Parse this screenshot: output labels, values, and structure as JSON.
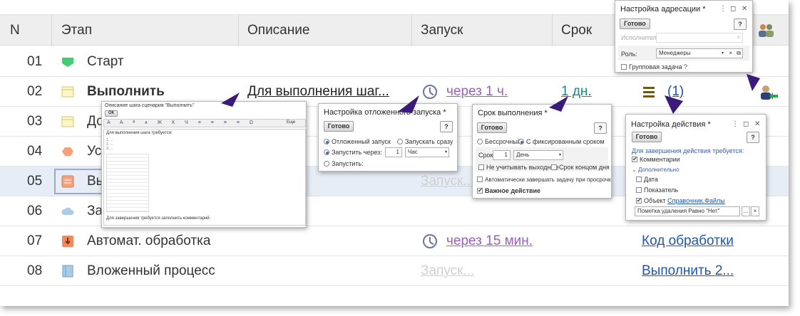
{
  "table": {
    "columns": {
      "n": "N",
      "stage": "Этап",
      "description": "Описание",
      "launch": "Запуск",
      "deadline": "Срок"
    },
    "rows": [
      {
        "n": "01",
        "name": "Старт",
        "icon": "start-icon"
      },
      {
        "n": "02",
        "name": "Выполнить",
        "description": "Для выполнения шаг...",
        "launch": "через 1 ч.",
        "deadline": "1 дн.",
        "actions": "(1)"
      },
      {
        "n": "03",
        "name": "До",
        "icon": "task-icon"
      },
      {
        "n": "04",
        "name": "Ус",
        "icon": "condition-icon"
      },
      {
        "n": "05",
        "name": "Вы",
        "launch": "Запуск..."
      },
      {
        "n": "06",
        "name": "За",
        "icon": "cloud-icon"
      },
      {
        "n": "07",
        "name": "Автомат. обработка",
        "launch": "через 15 мин.",
        "extra": "Код обработки"
      },
      {
        "n": "08",
        "name": "Вложенный процесс",
        "launch": "Запуск...",
        "extra": "Выполнить 2..."
      }
    ]
  },
  "popup_description": {
    "title": "Описание шага сценария \"Выполнить\"",
    "ok": "ОК",
    "toolbar_more": "Еще",
    "body_line": "Для выполнения шага требуется:",
    "footer": "Для завершения требуется заполнить комментарий."
  },
  "popup_delayed": {
    "title": "Настройка отложенного запуска *",
    "done": "Готово",
    "help": "?",
    "opt_delayed": "Отложенный запуск",
    "opt_now": "Запускать сразу",
    "opt_after": "Запустить через:",
    "after_value": "1",
    "after_unit": "Час",
    "opt_at": "Запустить:"
  },
  "popup_deadline": {
    "title": "Срок выполнения *",
    "done": "Готово",
    "help": "?",
    "opt_unlimited": "Бессрочный",
    "opt_fixed": "С фиксированным сроком",
    "term_label": "Срок:",
    "term_value": "1",
    "term_unit": "День",
    "ignore_weekends": "Не учитывать выходные",
    "end_of_day": "Срок концом дня",
    "auto_finish": "Автоматически завершать задачу при просрочке",
    "important": "Важное действие"
  },
  "popup_addressing": {
    "title": "Настройка адресации *",
    "done": "Готово",
    "help": "?",
    "executor_label": "Исполнитель:",
    "role_label": "Роль:",
    "role_value": "Менеджеры",
    "group_task": "Групповая задача",
    "group_help": "?"
  },
  "popup_action": {
    "title": "Настройка действия *",
    "done": "Готово",
    "help": "?",
    "required_label": "Для завершения действия требуется:",
    "comments": "Комментарии",
    "additional": "Дополнительно",
    "date": "Дата",
    "indicator": "Показатель",
    "object": "Объект",
    "object_link": "Справочник.Файлы",
    "filter_value": "Пометка удаления Равно \"Нет\""
  },
  "colors": {
    "header_bg": "#eeeeee",
    "link_purple": "#9a5fbf",
    "link_blue": "#1f55b5",
    "link_teal": "#178b8b",
    "arrow": "#3a1a7a"
  }
}
